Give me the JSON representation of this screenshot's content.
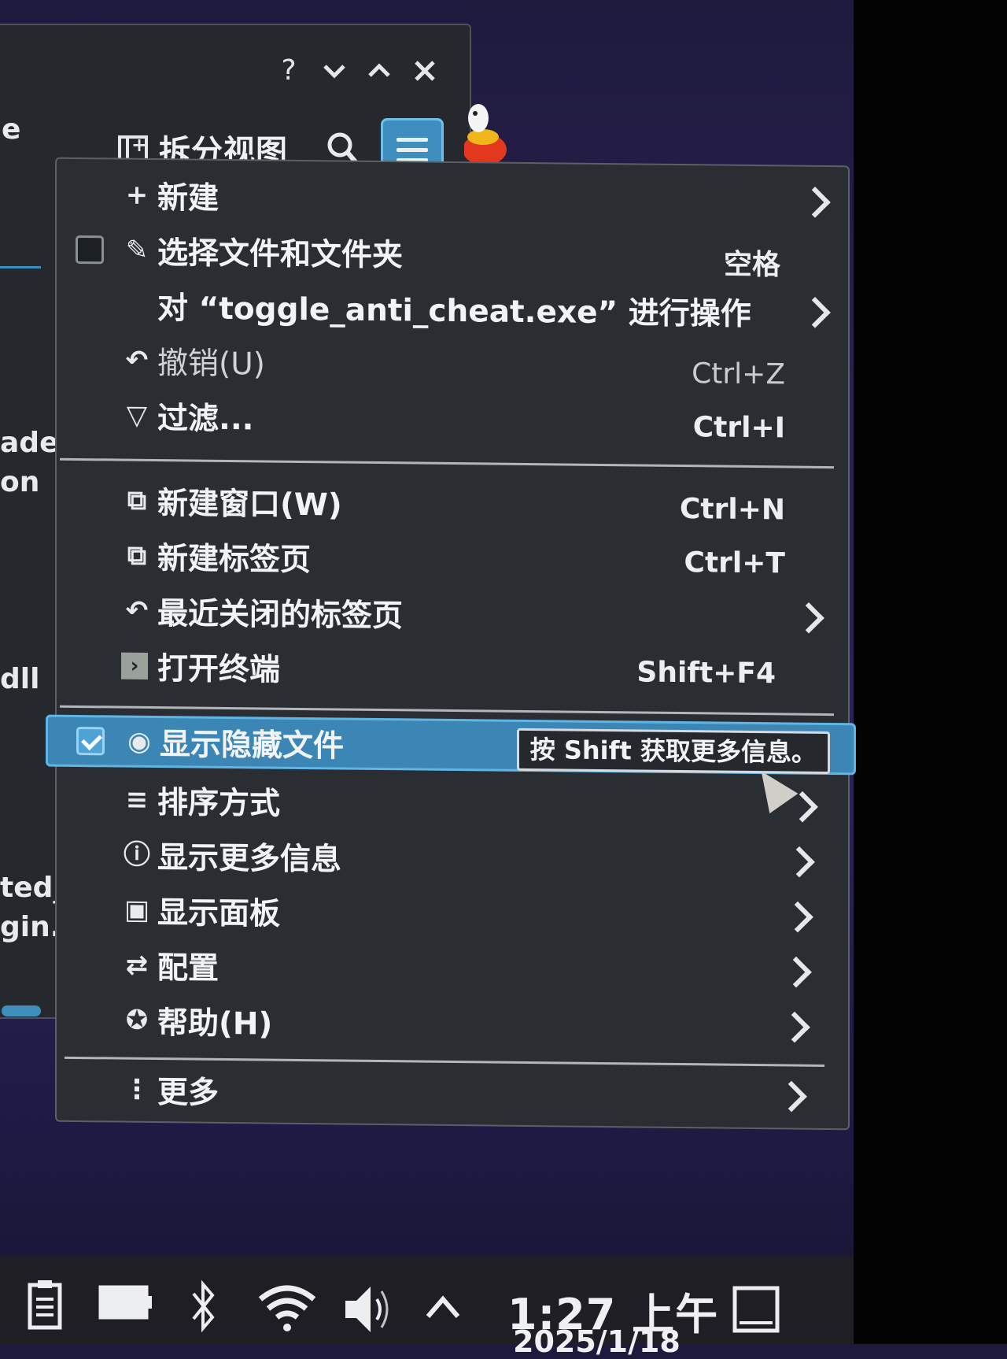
{
  "window": {
    "titlebar_buttons": {
      "help": "?",
      "minimize": "⌄",
      "maximize": "⌃",
      "close": "✕"
    },
    "toolbar": {
      "split_view_label": "拆分视图"
    },
    "left_fragments": [
      "e",
      "ade",
      "on",
      "dll",
      "ted_",
      "gin."
    ]
  },
  "menu": {
    "items": [
      {
        "label": "新建",
        "icon": "plus-icon",
        "shortcut": "",
        "submenu": true
      },
      {
        "label": "选择文件和文件夹",
        "icon": "select-icon",
        "shortcut": "空格",
        "submenu": false,
        "checkbox": false
      },
      {
        "label": "对 “toggle_anti_cheat.exe” 进行操作",
        "icon": "",
        "shortcut": "",
        "submenu": true
      },
      {
        "label": "撤销(U)",
        "icon": "undo-icon",
        "shortcut": "Ctrl+Z",
        "submenu": false,
        "disabled": true
      },
      {
        "label": "过滤...",
        "icon": "filter-icon",
        "shortcut": "Ctrl+I",
        "submenu": false
      },
      {
        "label": "新建窗口(W)",
        "icon": "new-window-icon",
        "shortcut": "Ctrl+N",
        "submenu": false
      },
      {
        "label": "新建标签页",
        "icon": "new-tab-icon",
        "shortcut": "Ctrl+T",
        "submenu": false
      },
      {
        "label": "最近关闭的标签页",
        "icon": "recent-closed-icon",
        "shortcut": "",
        "submenu": true
      },
      {
        "label": "打开终端",
        "icon": "terminal-icon",
        "shortcut": "Shift+F4",
        "submenu": false
      },
      {
        "label": "显示隐藏文件",
        "icon": "eye-icon",
        "shortcut": "",
        "submenu": false,
        "checkbox": true,
        "highlighted": true
      },
      {
        "label": "排序方式",
        "icon": "sort-icon",
        "shortcut": "",
        "submenu": true
      },
      {
        "label": "显示更多信息",
        "icon": "info-icon",
        "shortcut": "",
        "submenu": true
      },
      {
        "label": "显示面板",
        "icon": "panel-icon",
        "shortcut": "",
        "submenu": true
      },
      {
        "label": "配置",
        "icon": "configure-icon",
        "shortcut": "",
        "submenu": true
      },
      {
        "label": "帮助(H)",
        "icon": "help-icon",
        "shortcut": "",
        "submenu": true
      },
      {
        "label": "更多",
        "icon": "more-icon",
        "shortcut": "",
        "submenu": true
      }
    ],
    "tooltip": "按 Shift 获取更多信息。"
  },
  "taskbar": {
    "time": "1:27 上午",
    "date": "2025/1/18",
    "tray_icons": [
      "clipboard-icon",
      "battery-icon",
      "bluetooth-icon",
      "wifi-icon",
      "volume-icon",
      "expand-tray-icon"
    ]
  },
  "colors": {
    "accent": "#3b86b4",
    "accent_border": "#5fb5e4",
    "menu_bg": "#2a2e33",
    "desktop_bg": "#2a2252"
  }
}
